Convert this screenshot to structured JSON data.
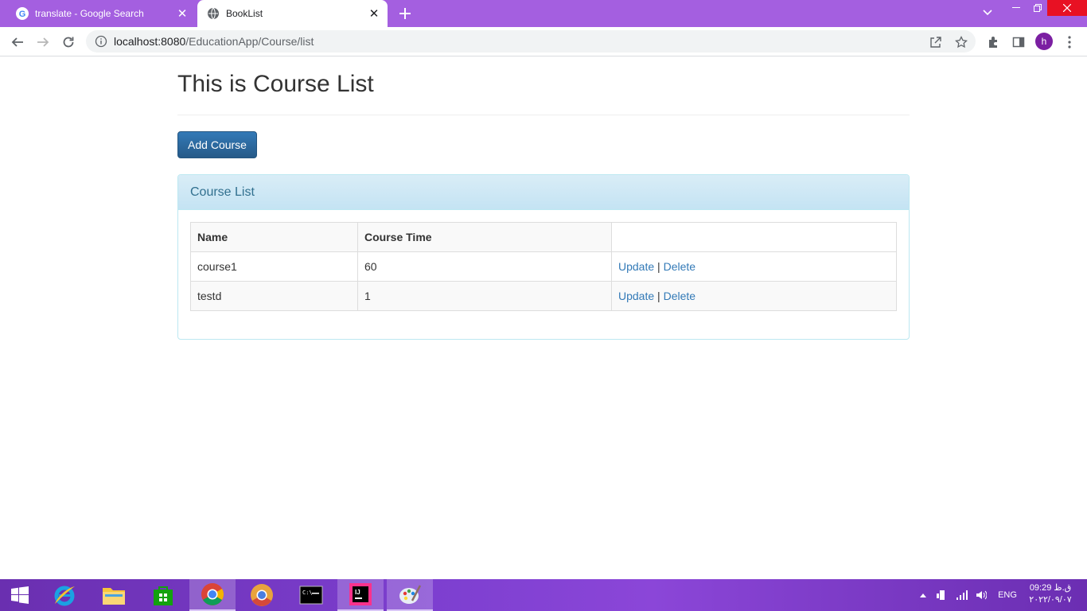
{
  "browser": {
    "tabs": [
      {
        "title": "translate - Google Search",
        "active": false
      },
      {
        "title": "BookList",
        "active": true
      }
    ],
    "url_host": "localhost:8080",
    "url_path": "/EducationApp/Course/list",
    "avatar_letter": "h",
    "accent": "#a45fe0"
  },
  "page": {
    "title": "This is Course List",
    "add_button": "Add Course",
    "panel_title": "Course List",
    "table": {
      "headers": [
        "Name",
        "Course Time",
        ""
      ],
      "rows": [
        {
          "name": "course1",
          "time": "60",
          "update": "Update",
          "sep": "|",
          "delete": "Delete"
        },
        {
          "name": "testd",
          "time": "1",
          "update": "Update",
          "sep": "|",
          "delete": "Delete"
        }
      ]
    }
  },
  "taskbar": {
    "apps": [
      "start-icon",
      "internet-explorer-icon",
      "file-explorer-icon",
      "store-icon",
      "chrome-icon",
      "chrome-alt-icon",
      "cmd-icon",
      "intellij-icon",
      "paint-icon"
    ],
    "language": "ENG",
    "time": "09:29 ق.ظ",
    "date": "۲۰۲۲/۰۹/۰۷"
  }
}
